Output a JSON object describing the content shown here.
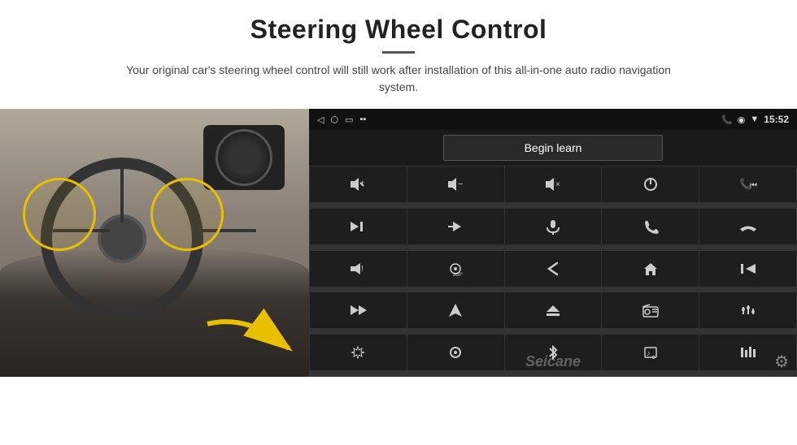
{
  "header": {
    "title": "Steering Wheel Control",
    "divider": true,
    "subtitle": "Your original car's steering wheel control will still work after installation of this all-in-one auto radio navigation system."
  },
  "status_bar": {
    "time": "15:52",
    "left_icons": [
      "◁",
      "□",
      "□"
    ],
    "right_icons": [
      "📞",
      "⊕",
      "▼"
    ]
  },
  "begin_learn": {
    "label": "Begin learn"
  },
  "grid_buttons": [
    {
      "icon": "🔊+",
      "row": 0,
      "col": 0
    },
    {
      "icon": "🔊-",
      "row": 0,
      "col": 1
    },
    {
      "icon": "🔇",
      "row": 0,
      "col": 2
    },
    {
      "icon": "⏻",
      "row": 0,
      "col": 3
    },
    {
      "icon": "📞⏮",
      "row": 0,
      "col": 4
    },
    {
      "icon": "⏭",
      "row": 1,
      "col": 0
    },
    {
      "icon": "⏭⏭",
      "row": 1,
      "col": 1
    },
    {
      "icon": "🎤",
      "row": 1,
      "col": 2
    },
    {
      "icon": "📞",
      "row": 1,
      "col": 3
    },
    {
      "icon": "↩",
      "row": 1,
      "col": 4
    },
    {
      "icon": "🔔",
      "row": 2,
      "col": 0
    },
    {
      "icon": "360",
      "row": 2,
      "col": 1
    },
    {
      "icon": "↺",
      "row": 2,
      "col": 2
    },
    {
      "icon": "⌂",
      "row": 2,
      "col": 3
    },
    {
      "icon": "⏮⏮",
      "row": 2,
      "col": 4
    },
    {
      "icon": "⏭⏭",
      "row": 3,
      "col": 0
    },
    {
      "icon": "▶",
      "row": 3,
      "col": 1
    },
    {
      "icon": "⏺",
      "row": 3,
      "col": 2
    },
    {
      "icon": "📻",
      "row": 3,
      "col": 3
    },
    {
      "icon": "⚙",
      "row": 3,
      "col": 4
    },
    {
      "icon": "✏",
      "row": 4,
      "col": 0
    },
    {
      "icon": "⊕",
      "row": 4,
      "col": 1
    },
    {
      "icon": "✱",
      "row": 4,
      "col": 2
    },
    {
      "icon": "♪",
      "row": 4,
      "col": 3
    },
    {
      "icon": "▐▐",
      "row": 4,
      "col": 4
    }
  ],
  "watermark": {
    "text": "Seicane"
  },
  "gear_icon": "⚙"
}
